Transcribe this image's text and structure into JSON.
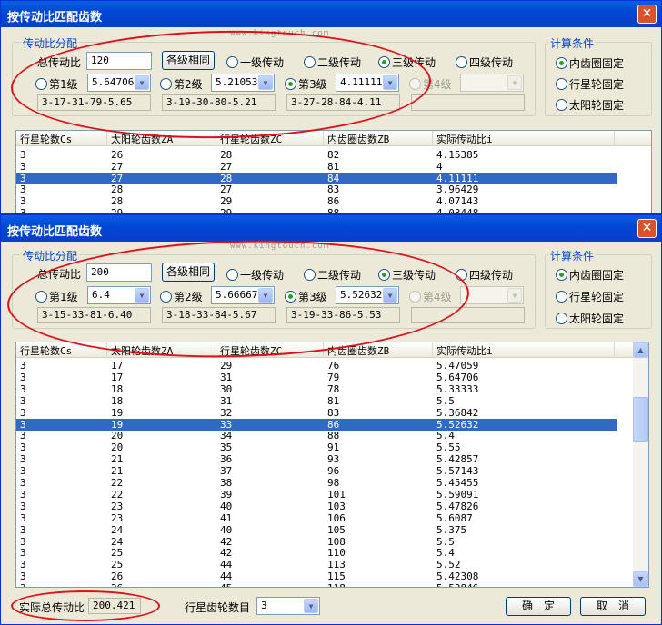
{
  "window1": {
    "title": "按传动比匹配齿数",
    "close": "✕",
    "watermark": "www.kingtouch.com",
    "group_ratio": "传动比分配",
    "total_label": "总传动比",
    "total_value": "120",
    "equal_btn": "各级相同",
    "modes": [
      "一级传动",
      "二级传动",
      "三级传动",
      "四级传动"
    ],
    "mode_selected": 2,
    "stage_labels": [
      "第1级",
      "第2级",
      "第3级",
      "第4级"
    ],
    "stage_values": [
      "5.64706",
      "5.21053",
      "4.11111",
      ""
    ],
    "stage_results": [
      "3-17-31-79-5.65",
      "3-19-30-80-5.21",
      "3-27-28-84-4.11",
      ""
    ],
    "stage_selected": 2,
    "group_cond": "计算条件",
    "conditions": [
      "内齿圈固定",
      "行星轮固定",
      "太阳轮固定"
    ],
    "cond_selected": 0,
    "columns": [
      "行星轮数Cs",
      "太阳轮齿数ZA",
      "行星轮齿数ZC",
      "内齿圈齿数ZB",
      "实际传动比i"
    ],
    "rows": [
      [
        "3",
        "26",
        "28",
        "82",
        "4.15385"
      ],
      [
        "3",
        "27",
        "27",
        "81",
        "4"
      ],
      [
        "3",
        "27",
        "28",
        "84",
        "4.11111"
      ],
      [
        "3",
        "28",
        "27",
        "83",
        "3.96429"
      ],
      [
        "3",
        "28",
        "29",
        "86",
        "4.07143"
      ],
      [
        "3",
        "29",
        "29",
        "88",
        "4.03448"
      ]
    ],
    "selected_row": 2
  },
  "window2": {
    "title": "按传动比匹配齿数",
    "close": "✕",
    "watermark": "www.kingtouch.com",
    "group_ratio": "传动比分配",
    "total_label": "总传动比",
    "total_value": "200",
    "equal_btn": "各级相同",
    "modes": [
      "一级传动",
      "二级传动",
      "三级传动",
      "四级传动"
    ],
    "mode_selected": 2,
    "stage_labels": [
      "第1级",
      "第2级",
      "第3级",
      "第4级"
    ],
    "stage_values": [
      "6.4",
      "5.66667",
      "5.52632",
      ""
    ],
    "stage_results": [
      "3-15-33-81-6.40",
      "3-18-33-84-5.67",
      "3-19-33-86-5.53",
      ""
    ],
    "stage_selected": 2,
    "group_cond": "计算条件",
    "conditions": [
      "内齿圈固定",
      "行星轮固定",
      "太阳轮固定"
    ],
    "cond_selected": 0,
    "columns": [
      "行星轮数Cs",
      "太阳轮齿数ZA",
      "行星轮齿数ZC",
      "内齿圈齿数ZB",
      "实际传动比i"
    ],
    "rows": [
      [
        "3",
        "17",
        "29",
        "76",
        "5.47059"
      ],
      [
        "3",
        "17",
        "31",
        "79",
        "5.64706"
      ],
      [
        "3",
        "18",
        "30",
        "78",
        "5.33333"
      ],
      [
        "3",
        "18",
        "31",
        "81",
        "5.5"
      ],
      [
        "3",
        "19",
        "32",
        "83",
        "5.36842"
      ],
      [
        "3",
        "19",
        "33",
        "86",
        "5.52632"
      ],
      [
        "3",
        "20",
        "34",
        "88",
        "5.4"
      ],
      [
        "3",
        "20",
        "35",
        "91",
        "5.55"
      ],
      [
        "3",
        "21",
        "36",
        "93",
        "5.42857"
      ],
      [
        "3",
        "21",
        "37",
        "96",
        "5.57143"
      ],
      [
        "3",
        "22",
        "38",
        "98",
        "5.45455"
      ],
      [
        "3",
        "22",
        "39",
        "101",
        "5.59091"
      ],
      [
        "3",
        "23",
        "40",
        "103",
        "5.47826"
      ],
      [
        "3",
        "23",
        "41",
        "106",
        "5.6087"
      ],
      [
        "3",
        "24",
        "40",
        "105",
        "5.375"
      ],
      [
        "3",
        "24",
        "42",
        "108",
        "5.5"
      ],
      [
        "3",
        "25",
        "42",
        "110",
        "5.4"
      ],
      [
        "3",
        "25",
        "44",
        "113",
        "5.52"
      ],
      [
        "3",
        "26",
        "44",
        "115",
        "5.42308"
      ],
      [
        "3",
        "26",
        "45",
        "118",
        "5.53846"
      ]
    ],
    "selected_row": 5,
    "footer": {
      "actual_label": "实际总传动比",
      "actual_value": "200.421",
      "planet_label": "行星齿轮数目",
      "planet_value": "3",
      "ok": "确　定",
      "cancel": "取　消"
    }
  },
  "icons": {
    "combo_arrow": "▼",
    "scroll_up": "▲",
    "scroll_down": "▼"
  },
  "colors": {
    "title_bar": "#0a5fe0",
    "selection": "#316ac5",
    "annotation": "#e0101a",
    "group_title": "#0046d5"
  }
}
